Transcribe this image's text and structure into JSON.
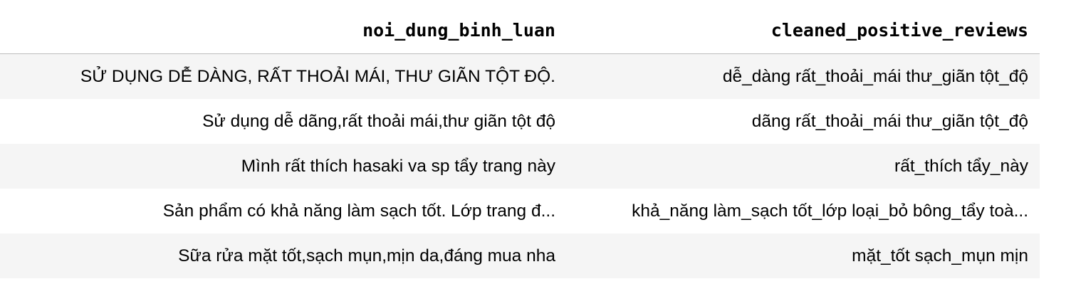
{
  "table": {
    "columns": [
      "noi_dung_binh_luan",
      "cleaned_positive_reviews"
    ],
    "rows": [
      [
        "SỬ DỤNG DỄ DÀNG, RẤT THOẢI MÁI, THƯ GIÃN TỘT ĐỘ.",
        "dễ_dàng rất_thoải_mái thư_giãn tột_độ"
      ],
      [
        "Sử dụng dễ dãng,rất thoải mái,thư giãn tột độ",
        "dãng rất_thoải_mái thư_giãn tột_độ"
      ],
      [
        "Mình rất thích hasaki va sp tẩy trang này",
        "rất_thích tẩy_này"
      ],
      [
        "Sản phẩm có khả năng làm sạch tốt. Lớp trang đ...",
        "khả_năng làm_sạch tốt_lớp loại_bỏ bông_tẩy toà..."
      ],
      [
        "Sữa rửa mặt tốt,sạch mụn,mịn da,đáng mua nha",
        "mặt_tốt sạch_mụn mịn"
      ]
    ]
  }
}
